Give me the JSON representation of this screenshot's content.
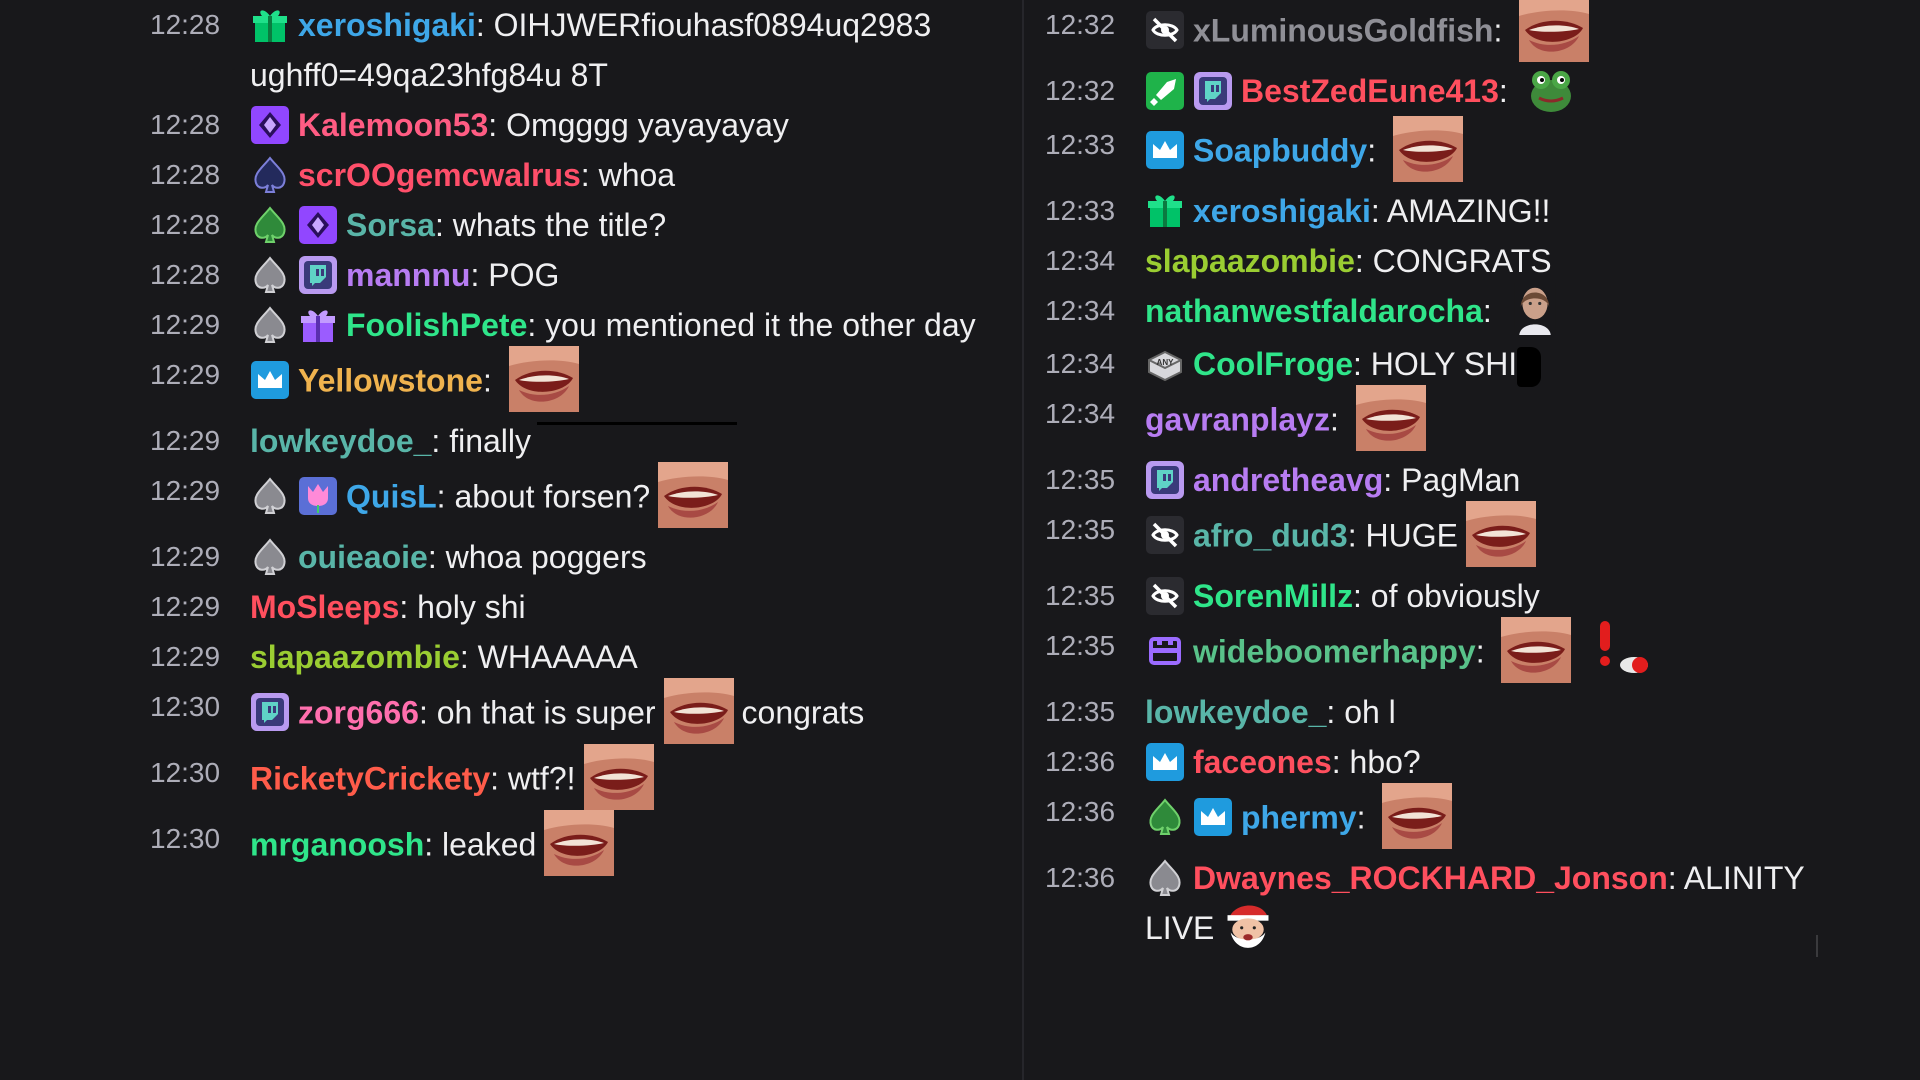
{
  "colors": {
    "background": "#18181b",
    "timestamp": "#adadb8",
    "message_text": "#efeff1"
  },
  "left_messages": [
    {
      "time": "12:28",
      "badges": [
        "gift-badge"
      ],
      "user": "xeroshigaki",
      "color": "#3ea7e8",
      "text": "OIHJWERfiouhasf0894uq2983 ughff0=49qa23hfg84u 8T"
    },
    {
      "time": "12:28",
      "badges": [
        "purple-diamond-badge"
      ],
      "user": "Kalemoon53",
      "color": "#ff5c83",
      "text": "Omgggg yayayayay"
    },
    {
      "time": "12:28",
      "badges": [
        "dark-spade-badge"
      ],
      "user": "scrOOgemcwalrus",
      "color": "#ff4f6a",
      "text": "whoa"
    },
    {
      "time": "12:28",
      "badges": [
        "green-spade-badge",
        "purple-diamond-badge"
      ],
      "user": "Sorsa",
      "color": "#59b5a8",
      "text": "whats the title?"
    },
    {
      "time": "12:28",
      "badges": [
        "grey-spade-badge",
        "glitch-badge"
      ],
      "user": "mannnu",
      "color": "#b77cf2",
      "text": "POG"
    },
    {
      "time": "12:29",
      "badges": [
        "grey-spade-badge",
        "purple-gift-badge"
      ],
      "user": "FoolishPete",
      "color": "#2fe58a",
      "text": "you mentioned it the other day"
    },
    {
      "time": "12:29",
      "badges": [
        "crown-badge"
      ],
      "user": "Yellowstone",
      "color": "#f0b34e",
      "text": "",
      "emote_after": true
    },
    {
      "time": "12:29",
      "badges": [],
      "user": "lowkeydoe_",
      "color": "#59b5a8",
      "text": "finally",
      "redacted": true
    },
    {
      "time": "12:29",
      "badges": [
        "grey-spade-badge",
        "tulip-badge"
      ],
      "user": "QuisL",
      "color": "#3ea7e8",
      "text": "about forsen?",
      "emote_after": true
    },
    {
      "time": "12:29",
      "badges": [
        "grey-spade-badge"
      ],
      "user": "ouieaoie",
      "color": "#59b5a8",
      "text": "whoa poggers"
    },
    {
      "time": "12:29",
      "badges": [],
      "user": "MoSleeps",
      "color": "#ff4f5e",
      "text": "holy shi"
    },
    {
      "time": "12:29",
      "badges": [],
      "user": "slapaazombie",
      "color": "#9acd32",
      "text": "WHAAAAA"
    },
    {
      "time": "12:30",
      "badges": [
        "glitch-badge"
      ],
      "user": "zorg666",
      "color": "#ff6fae",
      "text": "oh that is super",
      "emote_after": true,
      "text2": "congrats"
    },
    {
      "time": "12:30",
      "badges": [],
      "user": "RicketyCrickety",
      "color": "#ff5c4a",
      "text": "wtf?!",
      "emote_after": true
    },
    {
      "time": "12:30",
      "badges": [],
      "user": "mrganoosh",
      "color": "#2fe58a",
      "text": "leaked",
      "emote_after": true
    }
  ],
  "right_messages": [
    {
      "time": "12:32",
      "badges": [
        "no-audio-badge"
      ],
      "user": "xLuminousGoldfish",
      "color": "#8f8f96",
      "text": "",
      "emote_after": true
    },
    {
      "time": "12:32",
      "badges": [
        "green-sword-badge",
        "glitch-badge"
      ],
      "user": "BestZedEune413",
      "color": "#ff4f5e",
      "text": "",
      "frog_after": true
    },
    {
      "time": "12:33",
      "badges": [
        "crown-badge"
      ],
      "user": "Soapbuddy",
      "color": "#3ea7e8",
      "text": "",
      "emote_after": true
    },
    {
      "time": "12:33",
      "badges": [
        "gift-badge"
      ],
      "user": "xeroshigaki",
      "color": "#3ea7e8",
      "text": "AMAZING!!"
    },
    {
      "time": "12:34",
      "badges": [],
      "user": "slapaazombie",
      "color": "#9acd32",
      "text": "CONGRATS"
    },
    {
      "time": "12:34",
      "badges": [],
      "user": "nathanwestfaldarocha",
      "color": "#2fe58a",
      "text": "",
      "portrait_after": true
    },
    {
      "time": "12:34",
      "badges": [
        "any-key-badge"
      ],
      "user": "CoolFroge",
      "color": "#2fe58a",
      "text": "HOLY SHI",
      "mark_after": true
    },
    {
      "time": "12:34",
      "badges": [],
      "user": "gavranplayz",
      "color": "#b77cf2",
      "text": "",
      "emote_after": true
    },
    {
      "time": "12:35",
      "badges": [
        "glitch-badge"
      ],
      "user": "andretheavg",
      "color": "#b77cf2",
      "text": "PagMan"
    },
    {
      "time": "12:35",
      "badges": [
        "no-audio-badge"
      ],
      "user": "afro_dud3",
      "color": "#59b5a8",
      "text": "HUGE",
      "emote_after": true
    },
    {
      "time": "12:35",
      "badges": [
        "no-audio-badge"
      ],
      "user": "SorenMillz",
      "color": "#2fe58a",
      "text": "of obviously"
    },
    {
      "time": "12:35",
      "badges": [
        "purple-bits-badge"
      ],
      "user": "wideboomerhappy",
      "color": "#59c28a",
      "text": "",
      "emote_after": true,
      "bang_after": true
    },
    {
      "time": "12:35",
      "badges": [],
      "user": "lowkeydoe_",
      "color": "#59b5a8",
      "text": "oh l"
    },
    {
      "time": "12:36",
      "badges": [
        "crown-badge"
      ],
      "user": "faceones",
      "color": "#ff4f5e",
      "text": "hbo?"
    },
    {
      "time": "12:36",
      "badges": [
        "green-spade-badge",
        "crown-badge"
      ],
      "user": "phermy",
      "color": "#3ea7e8",
      "text": "",
      "emote_after": true
    },
    {
      "time": "12:36",
      "badges": [
        "grey-spade-badge"
      ],
      "user": "Dwaynes_ROCKHARD_Jonson",
      "color": "#ff4f5e",
      "text": "ALINITY LIVE",
      "santa_after": true
    }
  ]
}
